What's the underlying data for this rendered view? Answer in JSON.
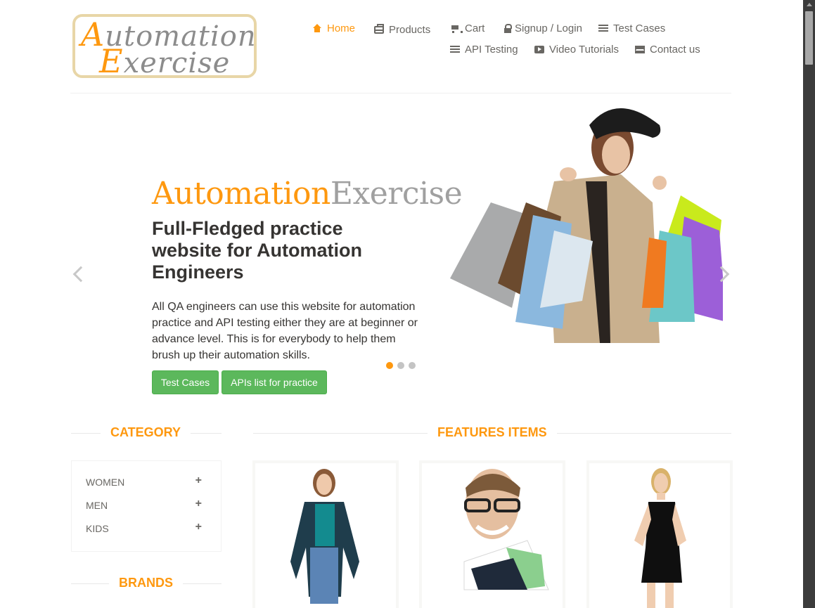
{
  "logo": {
    "line1_cap": "A",
    "line1_rest": "utomation",
    "line2_cap": "E",
    "line2_rest": "xercise"
  },
  "nav": {
    "home": "Home",
    "products": "Products",
    "cart": "Cart",
    "signup_login": "Signup / Login",
    "test_cases": "Test Cases",
    "api_testing": "API Testing",
    "video_tutorials": "Video Tutorials",
    "contact_us": "Contact us"
  },
  "slider": {
    "brand_part1": "Automation",
    "brand_part2": "Exercise",
    "heading": "Full-Fledged practice website for Automation Engineers",
    "text": "All QA engineers can use this website for automation practice and API testing either they are at beginner or advance level. This is for everybody to help them brush up their automation skills.",
    "btn_test_cases": "Test Cases",
    "btn_apis": "APIs list for practice",
    "active_slide": 1,
    "slide_count": 3
  },
  "sidebar": {
    "category_title": "CATEGORY",
    "categories": [
      {
        "label": "WOMEN",
        "toggle": "+"
      },
      {
        "label": "MEN",
        "toggle": "+"
      },
      {
        "label": "KIDS",
        "toggle": "+"
      }
    ],
    "brands_title": "BRANDS"
  },
  "features": {
    "title": "FEATURES ITEMS"
  },
  "colors": {
    "accent": "#fe980f",
    "button": "#5cb85c",
    "text": "#696763",
    "heading": "#363432"
  },
  "icons": {
    "home": "home-icon",
    "products": "briefcase-icon",
    "cart": "cart-icon",
    "login": "lock-icon",
    "test_cases": "list-icon",
    "api": "list-icon",
    "video": "youtube-play-icon",
    "contact": "envelope-icon"
  }
}
